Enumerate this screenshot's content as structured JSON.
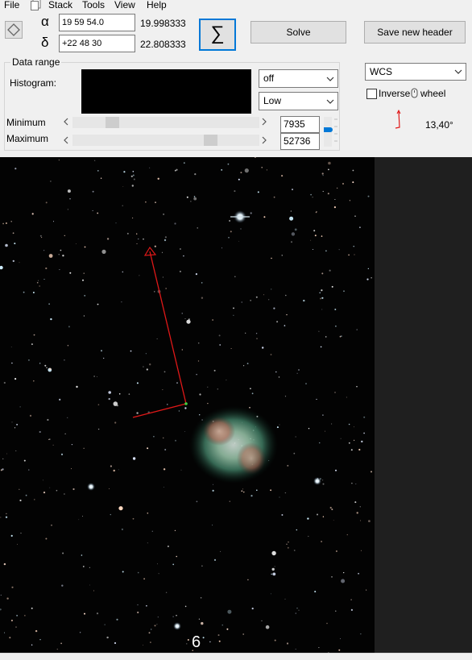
{
  "menu": {
    "file": "File",
    "stack": "Stack",
    "tools": "Tools",
    "view": "View",
    "help": "Help"
  },
  "coords": {
    "alpha_symbol": "α",
    "alpha_input": "19 59 54.0",
    "alpha_decimal": "19.998333",
    "delta_symbol": "δ",
    "delta_input": "+22 48 30",
    "delta_decimal": "22.808333"
  },
  "toolbar": {
    "sigma_label": "∑",
    "solve_label": "Solve",
    "save_header_label": "Save new header"
  },
  "data_range": {
    "group_label": "Data range",
    "histogram_label": "Histogram:",
    "histogram_select": "off",
    "stretch_select": "Low",
    "minimum_label": "Minimum",
    "maximum_label": "Maximum",
    "minimum_value": "7935",
    "maximum_value": "52736",
    "minimum_slider_level": 0.19,
    "maximum_slider_level": 0.76
  },
  "overlay": {
    "wcs_select": "WCS",
    "inverse_label": "Inverse",
    "wheel_label": "wheel",
    "inverse_checked": false,
    "angle_text": "13,40°"
  },
  "image": {
    "corner_label": "6"
  },
  "colors": {
    "accent": "#0078d7",
    "compass": "#e01818",
    "sigma_border": "#0078d7"
  },
  "icons": [
    "diamond-icon",
    "stack-icon",
    "chevron-down-icon",
    "mouse-icon",
    "compass-icon",
    "chevron-left-icon",
    "chevron-right-icon"
  ]
}
